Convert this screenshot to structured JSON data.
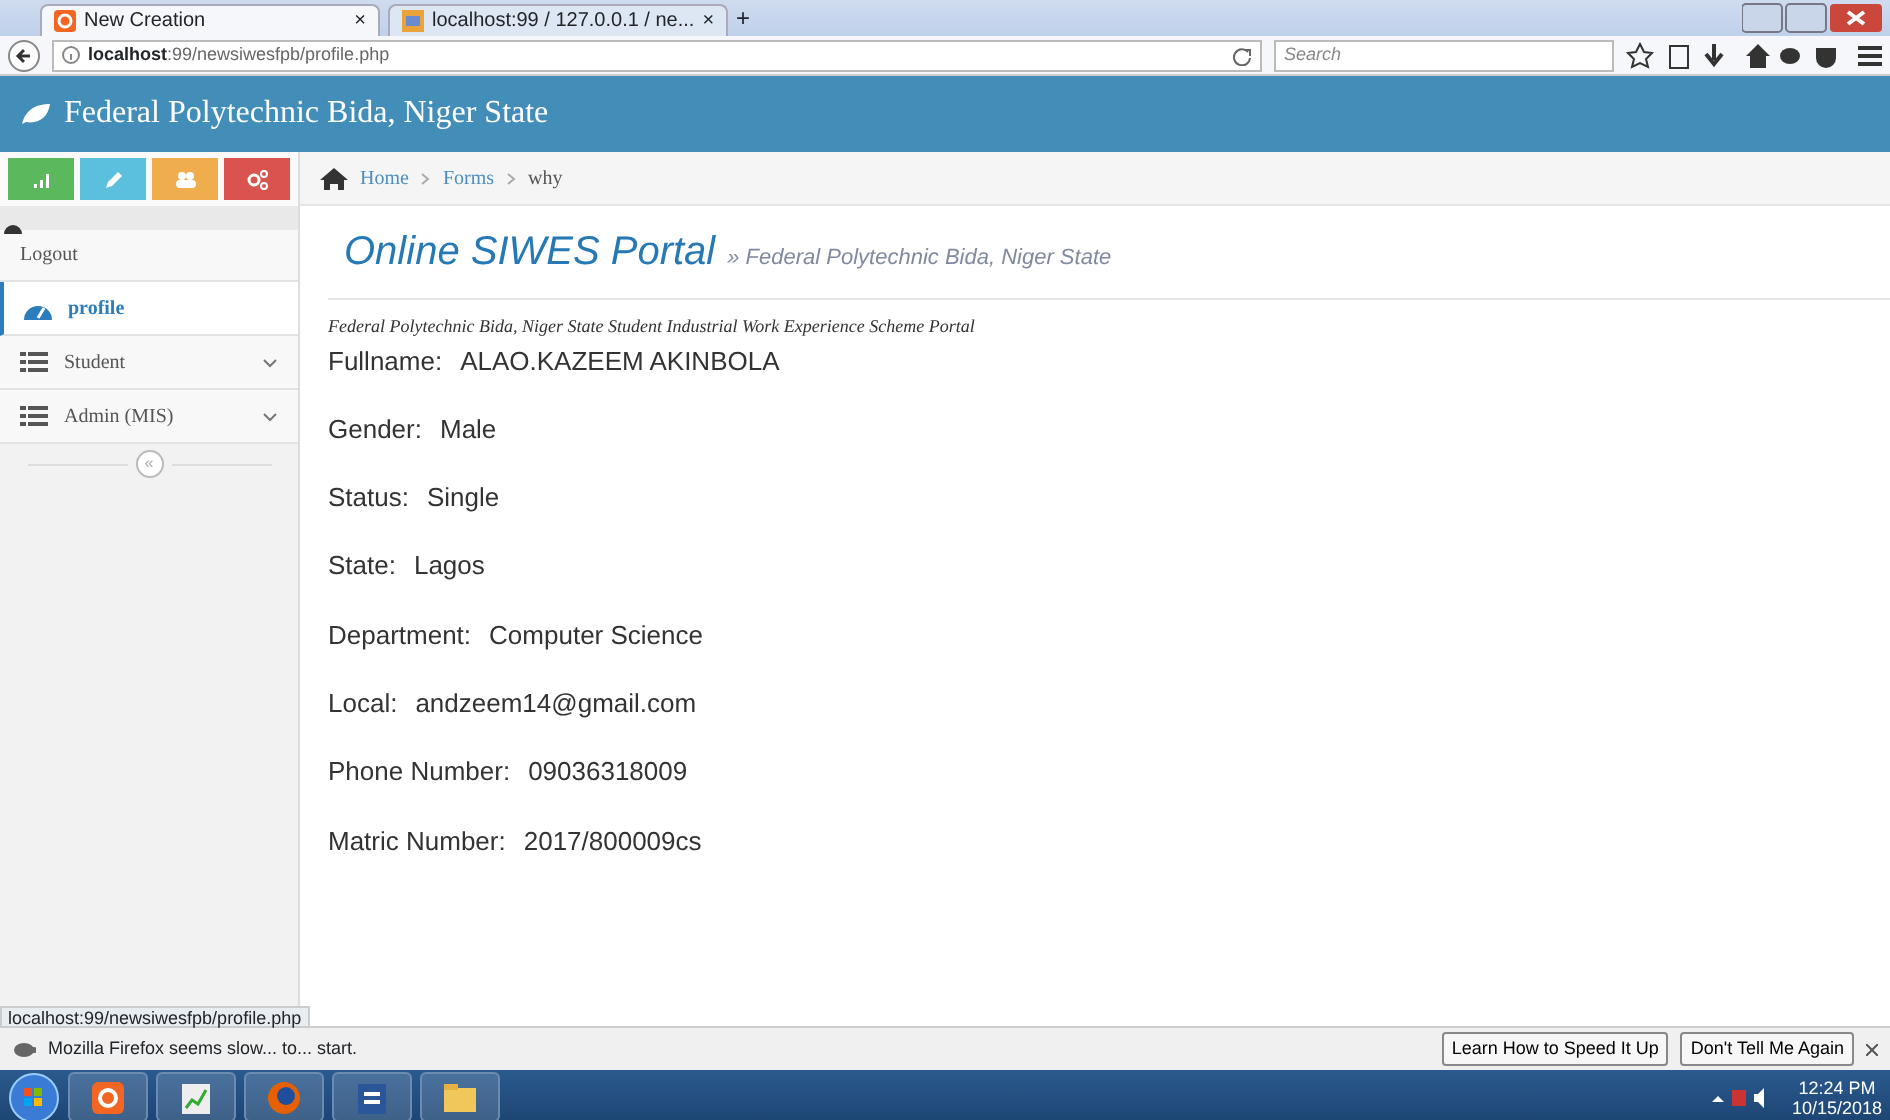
{
  "browser": {
    "tabs": [
      {
        "title": "New Creation",
        "selected": true,
        "close": "×"
      },
      {
        "title": "localhost:99 / 127.0.0.1 / ne...",
        "selected": false,
        "close": "×"
      }
    ],
    "new_tab": "+",
    "url_host": "localhost",
    "url_path": ":99/newsiwesfpb/profile.php",
    "search_placeholder": "Search"
  },
  "header": {
    "title": "Federal Polytechnic Bida, Niger State"
  },
  "shortcuts": [
    {
      "color": "#5cb85c"
    },
    {
      "color": "#5bc0de"
    },
    {
      "color": "#f0ad4e"
    },
    {
      "color": "#d9534f"
    }
  ],
  "sidebar": {
    "logout": "Logout",
    "items": [
      {
        "label": "profile",
        "selected": true,
        "expandable": false
      },
      {
        "label": "Student",
        "selected": false,
        "expandable": true
      },
      {
        "label": "Admin (MIS)",
        "selected": false,
        "expandable": true
      }
    ],
    "collapse": "«"
  },
  "breadcrumb": [
    "Home",
    "Forms",
    "why"
  ],
  "page": {
    "title": "Online SIWES Portal",
    "subtitle": "» Federal Polytechnic Bida, Niger State",
    "tagline": "Federal Polytechnic Bida, Niger State Student Industrial Work Experience Scheme Portal"
  },
  "profile": [
    {
      "label": "Fullname:",
      "value": "ALAO.KAZEEM AKINBOLA"
    },
    {
      "label": "Gender:",
      "value": "Male"
    },
    {
      "label": "Status:",
      "value": "Single"
    },
    {
      "label": "State:",
      "value": "Lagos"
    },
    {
      "label": "Department:",
      "value": "Computer Science"
    },
    {
      "label": "Local:",
      "value": "andzeem14@gmail.com"
    },
    {
      "label": "Phone Number:",
      "value": "09036318009"
    },
    {
      "label": "Matric Number:",
      "value": "2017/800009cs"
    }
  ],
  "status_url": "localhost:99/newsiwesfpb/profile.php",
  "notification": {
    "text": "Mozilla Firefox seems slow... to... start.",
    "buttons": [
      "Learn How to Speed It Up",
      "Don't Tell Me Again"
    ]
  },
  "taskbar": {
    "time": "12:24 PM",
    "date": "10/15/2018"
  }
}
